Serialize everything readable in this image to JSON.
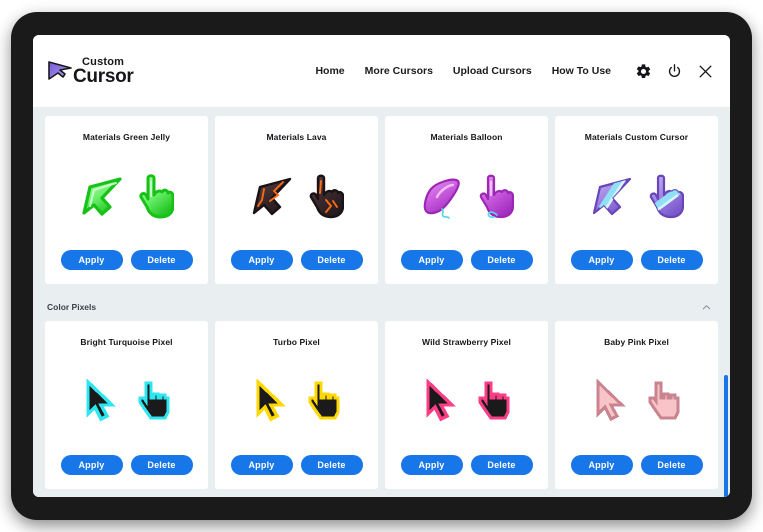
{
  "app": {
    "logo_top": "Custom",
    "logo_bottom": "Cursor",
    "logo_icon": "cursor-arrow-logo-icon"
  },
  "nav": {
    "links": [
      {
        "label": "Home",
        "name": "nav-home"
      },
      {
        "label": "More Cursors",
        "name": "nav-more-cursors"
      },
      {
        "label": "Upload Cursors",
        "name": "nav-upload-cursors"
      },
      {
        "label": "How To Use",
        "name": "nav-how-to-use"
      }
    ],
    "icons": [
      {
        "name": "gear-icon",
        "title": "Settings"
      },
      {
        "name": "power-icon",
        "title": "Power"
      },
      {
        "name": "close-icon",
        "title": "Close"
      }
    ]
  },
  "buttons": {
    "apply": "Apply",
    "delete": "Delete",
    "accent_color": "#1877e8"
  },
  "sections": [
    {
      "name": "materials-section",
      "heading": null,
      "cards": [
        {
          "title": "Materials Green Jelly",
          "style": "glossy",
          "arrow_color": "#3ee63e",
          "hand_color": "#3ee63e"
        },
        {
          "title": "Materials Lava",
          "style": "glossy",
          "arrow_color": "#4a3336",
          "hand_color": "#4a3336"
        },
        {
          "title": "Materials Balloon",
          "style": "glossy",
          "arrow_color": "#cc55dd",
          "hand_color": "#cc55dd"
        },
        {
          "title": "Materials Custom Cursor",
          "style": "glossy",
          "arrow_color": "#9b7ee0",
          "hand_color": "#9b7ee0"
        }
      ]
    },
    {
      "name": "color-pixels-section",
      "heading": "Color Pixels",
      "collapse_icon": "chevron-up-icon",
      "cards": [
        {
          "title": "Bright Turquoise Pixel",
          "style": "pixel",
          "outline_color": "#2ee6f0",
          "fill_color": "#1a1a1a"
        },
        {
          "title": "Turbo Pixel",
          "style": "pixel",
          "outline_color": "#ffd800",
          "fill_color": "#1a1a1a"
        },
        {
          "title": "Wild Strawberry Pixel",
          "style": "pixel",
          "outline_color": "#ff3c86",
          "fill_color": "#1a1a1a"
        },
        {
          "title": "Baby Pink Pixel",
          "style": "pixel",
          "outline_color": "#c9848f",
          "fill_color": "#f8c4c8"
        }
      ]
    }
  ],
  "scrollbar": {
    "color": "#1877e8"
  },
  "theme": {
    "page_background": "#e9eef1",
    "card_background": "#ffffff",
    "header_background": "#ffffff",
    "bezel_color": "#1a1a1a"
  }
}
